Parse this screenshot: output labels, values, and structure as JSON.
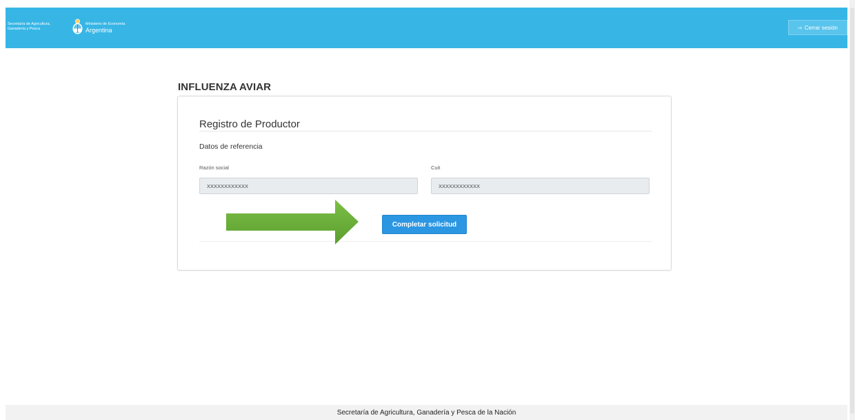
{
  "header": {
    "brand_secretaria_line1": "Secretaría de Agricultura,",
    "brand_secretaria_line2": "Ganadería y Pesca",
    "brand_ministerio_small": "Ministerio de Economía",
    "brand_ministerio_big": "Argentina",
    "logout_label": "Cerrar sesión",
    "logout_icon": "sign-out-icon",
    "emblem_icon": "coat-of-arms-icon",
    "color": "#37b6e6"
  },
  "page": {
    "title": "INFLUENZA AVIAR"
  },
  "card": {
    "title": "Registro de Productor",
    "section_label": "Datos de referencia",
    "fields": [
      {
        "label": "Razón social",
        "value": "XXXXXXXXXXXX"
      },
      {
        "label": "Cuit",
        "value": "XXXXXXXXXXXX"
      }
    ],
    "submit_label": "Completar solicitud",
    "submit_color": "#2b96e2"
  },
  "annotation": {
    "arrow_color": "#6aaa3a",
    "arrow_icon": "right-arrow-icon"
  },
  "footer": {
    "text": "Secretaría de Agricultura, Ganadería y Pesca de la Nación"
  }
}
